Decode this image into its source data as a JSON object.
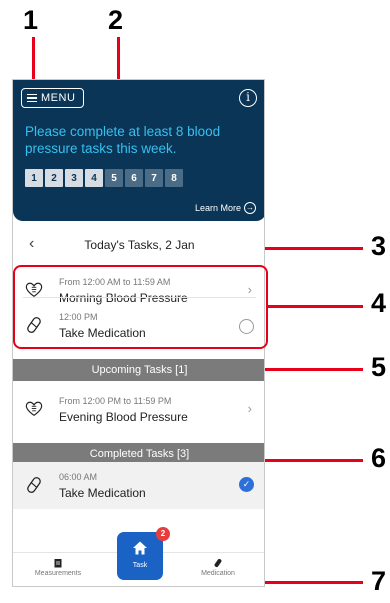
{
  "callouts": [
    "1",
    "2",
    "3",
    "4",
    "5",
    "6",
    "7"
  ],
  "hero": {
    "menu_label": "MENU",
    "info_glyph": "i",
    "message": "Please complete at least 8 blood pressure tasks this week.",
    "progress": [
      {
        "label": "1",
        "done": true
      },
      {
        "label": "2",
        "done": true
      },
      {
        "label": "3",
        "done": true
      },
      {
        "label": "4",
        "done": true
      },
      {
        "label": "5",
        "done": false
      },
      {
        "label": "6",
        "done": false
      },
      {
        "label": "7",
        "done": false
      },
      {
        "label": "8",
        "done": false
      }
    ],
    "learn_more": "Learn More"
  },
  "today": {
    "title": "Today's Tasks, 2 Jan",
    "tasks": [
      {
        "time": "From 12:00 AM to 11:59 AM",
        "name": "Morning Blood Pressure",
        "icon": "heart-icon",
        "action": "chevron"
      },
      {
        "time": "12:00 PM",
        "name": "Take Medication",
        "icon": "pill-icon",
        "action": "circle"
      }
    ]
  },
  "upcoming": {
    "header": "Upcoming Tasks [1]",
    "tasks": [
      {
        "time": "From 12:00 PM to 11:59 PM",
        "name": "Evening Blood Pressure",
        "icon": "heart-icon",
        "action": "chevron"
      }
    ]
  },
  "completed": {
    "header": "Completed Tasks [3]",
    "tasks": [
      {
        "time": "06:00 AM",
        "name": "Take Medication",
        "icon": "pill-icon",
        "action": "check"
      }
    ]
  },
  "nav": {
    "measurements": "Measurements",
    "task": "Task",
    "medication": "Medication",
    "badge_count": "2"
  },
  "colors": {
    "hero_bg": "#0a3556",
    "hero_text": "#36c0f0",
    "callout_line": "#e8001a",
    "section_bar": "#7b7b7b",
    "fab": "#1a63c5",
    "badge": "#e83d3d",
    "check": "#2e6fd8"
  }
}
